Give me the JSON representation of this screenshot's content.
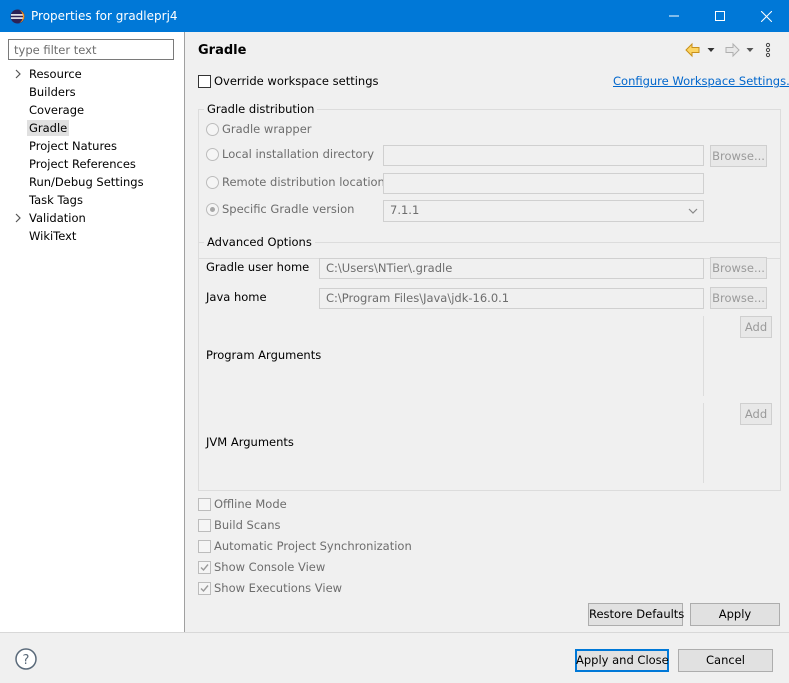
{
  "window": {
    "title": "Properties for gradleprj4",
    "controls": {
      "minimize": "minimize-icon",
      "maximize": "maximize-icon",
      "close": "close-icon"
    }
  },
  "filter": {
    "placeholder": "type filter text"
  },
  "tree": [
    {
      "label": "Resource",
      "expandable": true
    },
    {
      "label": "Builders",
      "expandable": false
    },
    {
      "label": "Coverage",
      "expandable": false
    },
    {
      "label": "Gradle",
      "expandable": false,
      "selected": true
    },
    {
      "label": "Project Natures",
      "expandable": false
    },
    {
      "label": "Project References",
      "expandable": false
    },
    {
      "label": "Run/Debug Settings",
      "expandable": false
    },
    {
      "label": "Task Tags",
      "expandable": false
    },
    {
      "label": "Validation",
      "expandable": true
    },
    {
      "label": "WikiText",
      "expandable": false
    }
  ],
  "page": {
    "title": "Gradle",
    "override_label": "Override workspace settings",
    "configure_link": "Configure Workspace Settings...",
    "distribution": {
      "title": "Gradle distribution",
      "options": [
        {
          "label": "Gradle wrapper",
          "selected": false
        },
        {
          "label": "Local installation directory",
          "selected": false,
          "value": "",
          "button": "Browse..."
        },
        {
          "label": "Remote distribution location",
          "selected": false,
          "value": ""
        },
        {
          "label": "Specific Gradle version",
          "selected": true,
          "value": "7.1.1"
        }
      ]
    },
    "advanced": {
      "title": "Advanced Options",
      "gradle_user_home": {
        "label": "Gradle user home",
        "value": "C:\\Users\\NTier\\.gradle",
        "button": "Browse..."
      },
      "java_home": {
        "label": "Java home",
        "value": "C:\\Program Files\\Java\\jdk-16.0.1",
        "button": "Browse..."
      },
      "program_args": {
        "label": "Program Arguments",
        "button": "Add"
      },
      "jvm_args": {
        "label": "JVM Arguments",
        "button": "Add"
      }
    },
    "checkboxes": [
      {
        "label": "Offline Mode",
        "checked": false
      },
      {
        "label": "Build Scans",
        "checked": false
      },
      {
        "label": "Automatic Project Synchronization",
        "checked": false
      },
      {
        "label": "Show Console View",
        "checked": true
      },
      {
        "label": "Show Executions View",
        "checked": true
      }
    ],
    "restore_defaults": "Restore Defaults",
    "apply": "Apply"
  },
  "footer": {
    "help_icon": "help-icon",
    "apply_close": "Apply and Close",
    "cancel": "Cancel"
  }
}
